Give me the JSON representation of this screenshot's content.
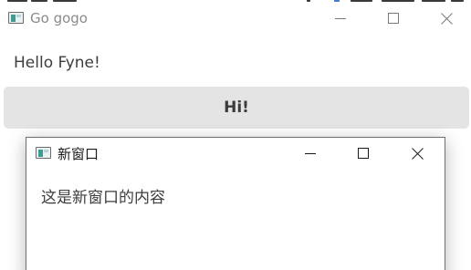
{
  "main_window": {
    "title": "Go gogo",
    "icon": "app-window-icon",
    "controls": {
      "minimize": "minimize-icon",
      "maximize": "maximize-icon",
      "close": "close-icon"
    },
    "label": "Hello Fyne!",
    "button_label": "Hi!"
  },
  "popup_window": {
    "title": "新窗口",
    "icon": "app-window-icon",
    "controls": {
      "minimize": "minimize-icon",
      "maximize": "maximize-icon",
      "close": "close-icon"
    },
    "content": "这是新窗口的内容"
  },
  "colors": {
    "window_bg": "#ffffff",
    "button_bg": "#e4e4e4",
    "text": "#3d3d3d",
    "inactive_title": "#8a8a8a",
    "popup_border": "#6f6f6f"
  }
}
